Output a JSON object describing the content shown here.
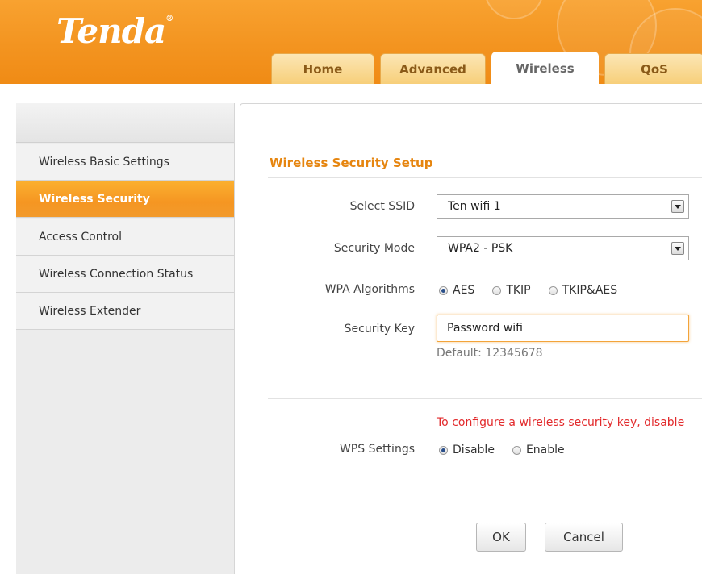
{
  "brand": {
    "logo": "Tenda",
    "reg": "®"
  },
  "tabs": [
    {
      "label": "Home"
    },
    {
      "label": "Advanced"
    },
    {
      "label": "Wireless"
    },
    {
      "label": "QoS"
    }
  ],
  "sidebar": {
    "items": [
      {
        "label": "Wireless Basic Settings"
      },
      {
        "label": "Wireless Security"
      },
      {
        "label": "Access Control"
      },
      {
        "label": "Wireless Connection Status"
      },
      {
        "label": "Wireless Extender"
      }
    ]
  },
  "main": {
    "title": "Wireless Security Setup",
    "ssid": {
      "label": "Select SSID",
      "value": "Ten wifi 1"
    },
    "security_mode": {
      "label": "Security Mode",
      "value": "WPA2 - PSK"
    },
    "wpa": {
      "label": "WPA Algorithms",
      "options": [
        "AES",
        "TKIP",
        "TKIP&AES"
      ],
      "selected": "AES"
    },
    "key": {
      "label": "Security Key",
      "value": "Password wifi",
      "hint": "Default: 12345678"
    },
    "warning": "To configure a wireless security key, disable",
    "wps": {
      "label": "WPS Settings",
      "options": [
        "Disable",
        "Enable"
      ],
      "selected": "Disable"
    },
    "ok_label": "OK",
    "cancel_label": "Cancel"
  },
  "colors": {
    "accent": "#f39420",
    "title": "#e6850f",
    "warning": "#e2292b"
  }
}
